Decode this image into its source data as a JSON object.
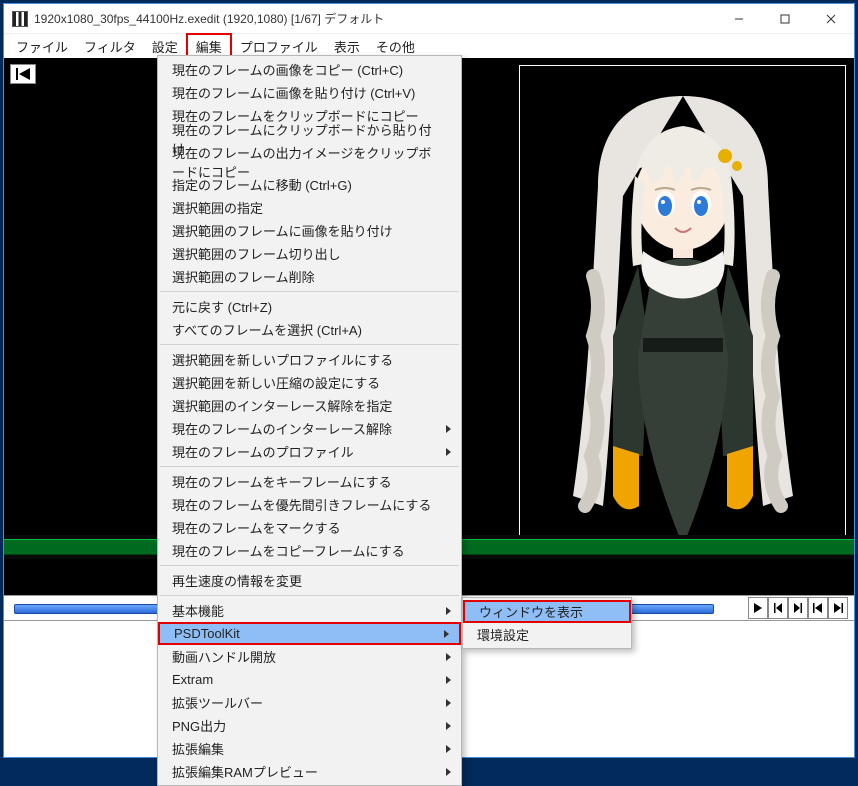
{
  "titlebar": {
    "text": "1920x1080_30fps_44100Hz.exedit (1920,1080) [1/67] デフォルト"
  },
  "menubar": {
    "items": [
      "ファイル",
      "フィルタ",
      "設定",
      "編集",
      "プロファイル",
      "表示",
      "その他"
    ],
    "active_index": 3
  },
  "dropdown": {
    "groups": [
      [
        {
          "label": "現在のフレームの画像をコピー (Ctrl+C)"
        },
        {
          "label": "現在のフレームに画像を貼り付け (Ctrl+V)"
        },
        {
          "label": "現在のフレームをクリップボードにコピー"
        },
        {
          "label": "現在のフレームにクリップボードから貼り付け"
        },
        {
          "label": "現在のフレームの出力イメージをクリップボードにコピー"
        },
        {
          "label": "指定のフレームに移動 (Ctrl+G)"
        },
        {
          "label": "選択範囲の指定"
        },
        {
          "label": "選択範囲のフレームに画像を貼り付け"
        },
        {
          "label": "選択範囲のフレーム切り出し"
        },
        {
          "label": "選択範囲のフレーム削除"
        }
      ],
      [
        {
          "label": "元に戻す (Ctrl+Z)"
        },
        {
          "label": "すべてのフレームを選択 (Ctrl+A)"
        }
      ],
      [
        {
          "label": "選択範囲を新しいプロファイルにする"
        },
        {
          "label": "選択範囲を新しい圧縮の設定にする"
        },
        {
          "label": "選択範囲のインターレース解除を指定"
        },
        {
          "label": "現在のフレームのインターレース解除",
          "arrow": true
        },
        {
          "label": "現在のフレームのプロファイル",
          "arrow": true
        }
      ],
      [
        {
          "label": "現在のフレームをキーフレームにする"
        },
        {
          "label": "現在のフレームを優先間引きフレームにする"
        },
        {
          "label": "現在のフレームをマークする"
        },
        {
          "label": "現在のフレームをコピーフレームにする"
        }
      ],
      [
        {
          "label": "再生速度の情報を変更"
        }
      ],
      [
        {
          "label": "基本機能",
          "arrow": true
        },
        {
          "label": "PSDToolKit",
          "arrow": true,
          "boxed": true
        },
        {
          "label": "動画ハンドル開放",
          "arrow": true
        },
        {
          "label": "Extram",
          "arrow": true
        },
        {
          "label": "拡張ツールバー",
          "arrow": true
        },
        {
          "label": "PNG出力",
          "arrow": true
        },
        {
          "label": "拡張編集",
          "arrow": true
        },
        {
          "label": "拡張編集RAMプレビュー",
          "arrow": true
        }
      ]
    ]
  },
  "submenu": {
    "items": [
      {
        "label": "ウィンドウを表示",
        "boxed": true
      },
      {
        "label": "環境設定"
      }
    ]
  }
}
